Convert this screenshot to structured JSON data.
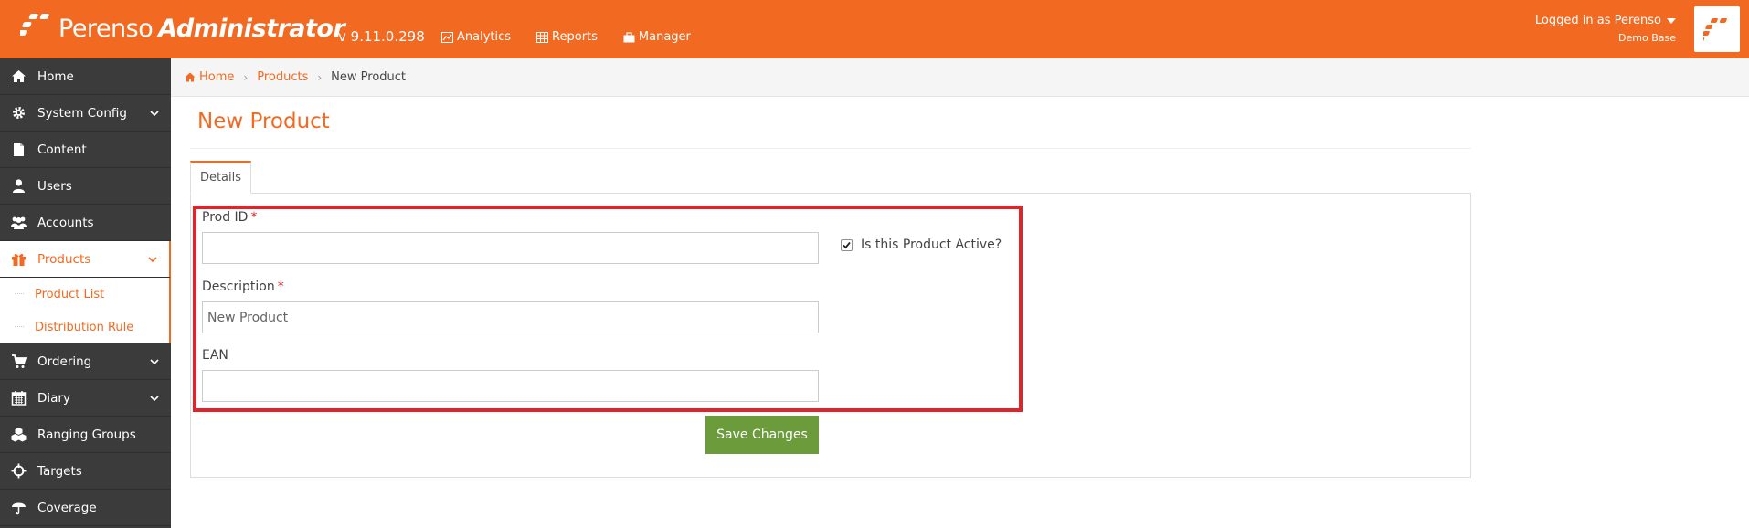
{
  "brand": {
    "name_light": "Perenso",
    "name_bold": "Administrator",
    "accent": "#f26a22",
    "sidebar_bg": "#3b3b3b",
    "save_color": "#6c9b3c",
    "highlight_color": "#e0242b"
  },
  "header": {
    "version": "v 9.11.0.298",
    "nav": [
      {
        "label": "Analytics",
        "icon": "analytics-icon"
      },
      {
        "label": "Reports",
        "icon": "table-icon"
      },
      {
        "label": "Manager",
        "icon": "briefcase-icon"
      }
    ],
    "user": {
      "logged_in_text": "Logged in as Perenso",
      "database": "Demo Base"
    }
  },
  "sidebar": {
    "items": [
      {
        "label": "Home",
        "icon": "home-icon"
      },
      {
        "label": "System Config",
        "icon": "gear-icon",
        "expandable": true
      },
      {
        "label": "Content",
        "icon": "document-icon"
      },
      {
        "label": "Users",
        "icon": "user-icon"
      },
      {
        "label": "Accounts",
        "icon": "users-icon"
      },
      {
        "label": "Products",
        "icon": "gift-icon",
        "expandable": true,
        "active": true,
        "children": [
          {
            "label": "Product List"
          },
          {
            "label": "Distribution Rule"
          }
        ]
      },
      {
        "label": "Ordering",
        "icon": "cart-icon",
        "expandable": true
      },
      {
        "label": "Diary",
        "icon": "calendar-icon",
        "expandable": true
      },
      {
        "label": "Ranging Groups",
        "icon": "cubes-icon"
      },
      {
        "label": "Targets",
        "icon": "crosshair-icon"
      },
      {
        "label": "Coverage",
        "icon": "umbrella-icon"
      }
    ]
  },
  "breadcrumb": {
    "home": "Home",
    "section": "Products",
    "current": "New Product"
  },
  "page": {
    "title": "New Product",
    "tab_label": "Details"
  },
  "form": {
    "prod_id": {
      "label": "Prod ID",
      "required_mark": "*",
      "value": ""
    },
    "description": {
      "label": "Description",
      "required_mark": "*",
      "value": "",
      "placeholder": "New Product"
    },
    "ean": {
      "label": "EAN",
      "value": ""
    },
    "active": {
      "label": "Is this Product Active?",
      "checked": true
    },
    "save_label": "Save Changes"
  }
}
